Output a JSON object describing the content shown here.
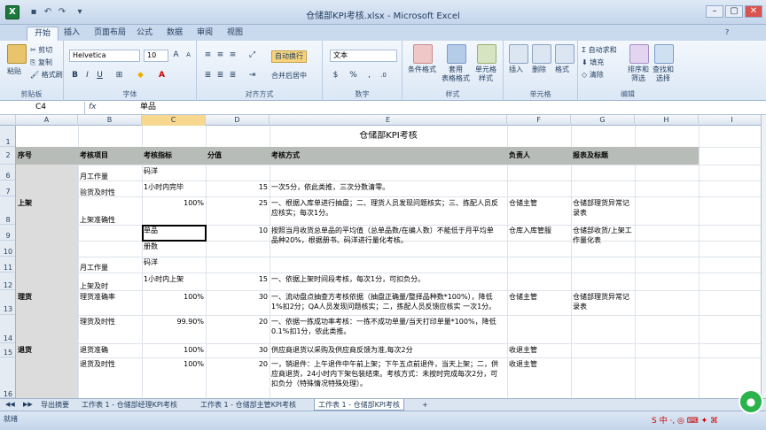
{
  "window": {
    "title": "仓储部KPI考核.xlsx - Microsoft Excel"
  },
  "ribbon": {
    "tabs": [
      "开始",
      "插入",
      "页面布局",
      "公式",
      "数据",
      "审阅",
      "视图"
    ],
    "clipboard": {
      "paste": "粘贴",
      "cut": "剪切",
      "copy": "复制",
      "format_painter": "格式刷",
      "label": "剪贴板"
    },
    "font": {
      "name": "Helvetica",
      "size": "10",
      "label": "字体"
    },
    "alignment": {
      "wrap": "自动换行",
      "merge": "合并后居中",
      "label": "对齐方式"
    },
    "number": {
      "format": "文本",
      "label": "数字"
    },
    "styles": {
      "conditional": "条件格式",
      "table": "套用\n表格格式",
      "cell": "单元格\n样式",
      "label": "样式"
    },
    "cells": {
      "insert": "插入",
      "delete": "删除",
      "format": "格式",
      "label": "单元格"
    },
    "editing": {
      "autosum": "自动求和",
      "fill": "填充",
      "clear": "清除",
      "sort": "排序和\n筛选",
      "find": "查找和\n选择",
      "label": "编辑"
    }
  },
  "formula_bar": {
    "name_box": "C4",
    "fx": "fx",
    "content": "单品"
  },
  "columns": [
    "A",
    "B",
    "C",
    "D",
    "E",
    "F",
    "G",
    "H",
    "I"
  ],
  "rows": [
    "1",
    "2",
    "6",
    "7",
    "8",
    "9",
    "10",
    "11",
    "12",
    "13",
    "14",
    "15",
    "16"
  ],
  "sheet": {
    "title": "仓储部KPI考核",
    "headers": [
      "序号",
      "考核项目",
      "考核指标",
      "分值",
      "考核方式",
      "负责人",
      "报表及标题"
    ],
    "cells": [
      {
        "text": "码洋"
      },
      {
        "text": "月工作量"
      },
      {
        "text": "1小时内完毕"
      },
      {
        "text": "15"
      },
      {
        "text": "一次5分，依此类推，三次分数清零。"
      },
      {
        "text": "验货及时性"
      },
      {
        "text": "上架"
      },
      {
        "text": "100%"
      },
      {
        "text": "25"
      },
      {
        "text": "一、根据入库单进行抽盘；二、理货人员发现问题核实；三、拣配人员反\n应核实；每次1分。"
      },
      {
        "text": "仓储主管"
      },
      {
        "text": "仓储部理货异常记\n录表"
      },
      {
        "text": "上架准确性"
      },
      {
        "text": "单品"
      },
      {
        "text": "10"
      },
      {
        "text": "按照当月收货总单品的平均值（总单品数/在编人数）不能低于月平均单\n品种20%，根据册书、码洋进行量化考核。"
      },
      {
        "text": "仓库入库管服"
      },
      {
        "text": "仓储部收货/上架工\n作量化表"
      },
      {
        "text": "册数"
      },
      {
        "text": "码洋"
      },
      {
        "text": "月工作量"
      },
      {
        "text": "1小时内上架"
      },
      {
        "text": "15"
      },
      {
        "text": "一、依据上架时间段考核，每次1分，可扣负分。"
      },
      {
        "text": "上架及时"
      },
      {
        "text": "理货"
      },
      {
        "text": "理货准确率"
      },
      {
        "text": "100%"
      },
      {
        "text": "30"
      },
      {
        "text": "一、流动盘点抽查方考核依据（抽盘正确量/整择品种数*100%），降低\n1%扣2分；QA人员发现问题核实；二，拣配人员反馈应核实 一次1分。"
      },
      {
        "text": "仓储主管"
      },
      {
        "text": "仓储部理货异常记\n录表"
      },
      {
        "text": "理货及时性"
      },
      {
        "text": "99.90%"
      },
      {
        "text": "20"
      },
      {
        "text": "一、依据一拣成功率考核：一拣不成功单量/当天打印单量*100%，降低\n0.1%扣1分，依此类推。"
      },
      {
        "text": "退货"
      },
      {
        "text": "退货准确"
      },
      {
        "text": "100%"
      },
      {
        "text": "30"
      },
      {
        "text": "供应商退货以采购及供应商反馈为准,每次2分"
      },
      {
        "text": "收退主管"
      },
      {
        "text": "退货及时性"
      },
      {
        "text": "100%"
      },
      {
        "text": "20"
      },
      {
        "text": "一，销退件：上午退件中午前上架；下午五点前退件，当天上架；二，供\n应商退货，24小时内下架包装结束。考核方式：未按时完成每次2分，可\n扣负分（特殊情况特殊处理）。"
      },
      {
        "text": "收退主管"
      }
    ]
  },
  "sheet_tabs": [
    "导出摘要",
    "工作表 1 - 仓储部经理KPI考核",
    "工作表 1 - 仓储部主管KPI考核",
    "工作表 1 - 仓储部KPI考核"
  ],
  "status": {
    "ready": "就绪",
    "ime": "S 中 ·, ◎ ⌨ ✦ ⌘"
  }
}
